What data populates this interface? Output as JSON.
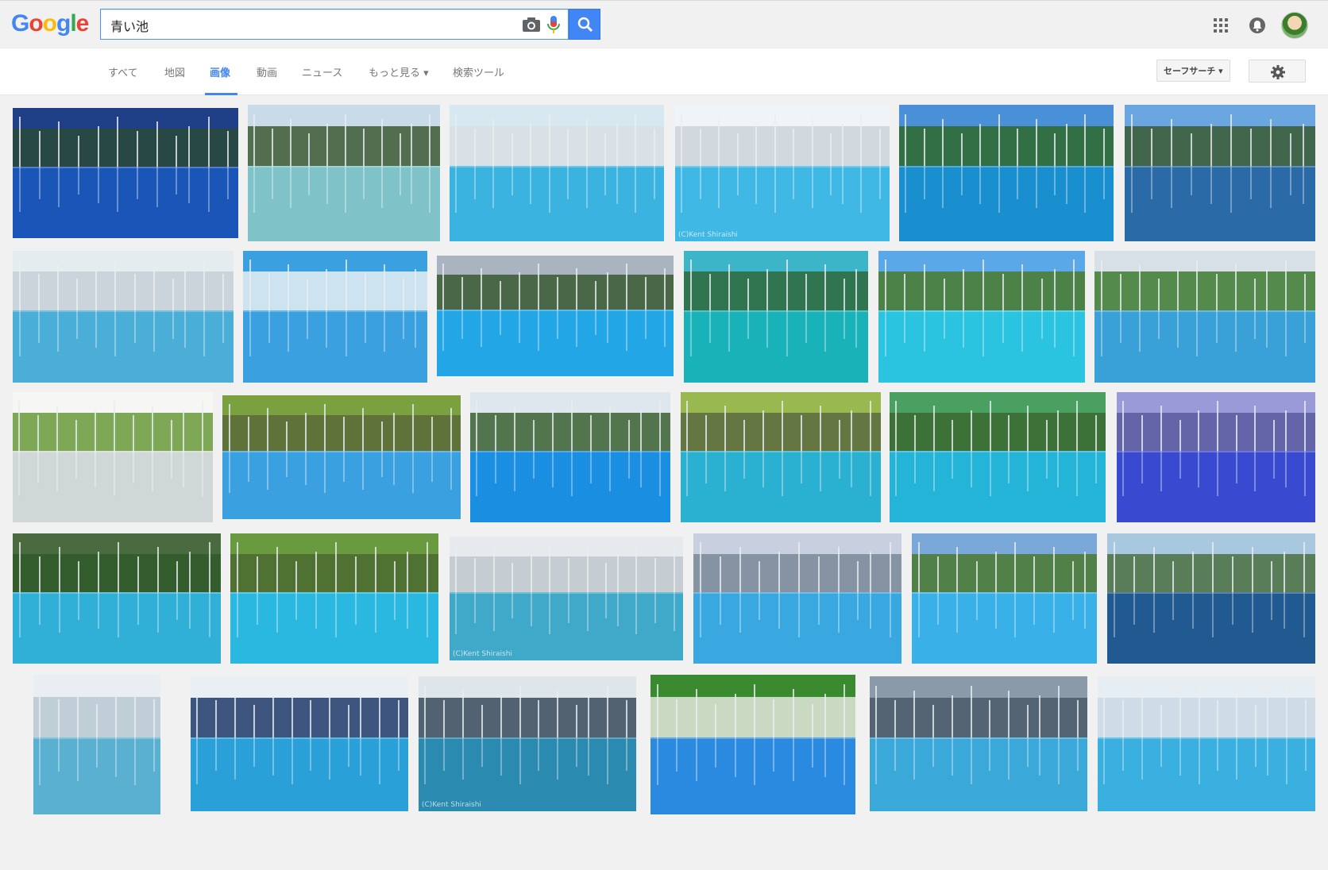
{
  "logo": {
    "letters": [
      "G",
      "o",
      "o",
      "g",
      "l",
      "e"
    ],
    "colors": [
      "#4285f4",
      "#ea4335",
      "#fbbc05",
      "#4285f4",
      "#34a853",
      "#ea4335"
    ]
  },
  "search": {
    "query": "青い池"
  },
  "nav": {
    "tabs": [
      {
        "label": "すべて",
        "active": false
      },
      {
        "label": "地図",
        "active": false
      },
      {
        "label": "画像",
        "active": true
      },
      {
        "label": "動画",
        "active": false
      },
      {
        "label": "ニュース",
        "active": false
      },
      {
        "label": "もっと見る ▾",
        "active": false
      },
      {
        "label": "検索ツール",
        "active": false
      }
    ],
    "safesearch_label": "セーフサーチ ▾"
  },
  "icons": {
    "camera": "camera-icon",
    "mic": "mic-icon",
    "search": "search-icon",
    "apps": "apps-grid-icon",
    "notifications": "notifications-icon",
    "settings": "gear-icon"
  },
  "colors": {
    "accent": "#4285f4",
    "header_bg": "#f1f1f1"
  },
  "images": {
    "rows": [
      [
        {
          "sky": "#1f3f86",
          "trees": "#2a4a3a",
          "water": "#1a56b8",
          "watermark": ""
        },
        {
          "sky": "#c9dbe8",
          "trees": "#3e5a34",
          "water": "#7fc3c8",
          "watermark": ""
        },
        {
          "sky": "#d8e8f0",
          "trees": "#d9dfe4",
          "water": "#3ab3e0",
          "watermark": ""
        },
        {
          "sky": "#eef4f8",
          "trees": "#cbd4da",
          "water": "#3fb8e6",
          "watermark": "(C)Kent Shiraishi"
        },
        {
          "sky": "#4a90d9",
          "trees": "#2f6a2a",
          "water": "#1a8fd0",
          "watermark": ""
        },
        {
          "sky": "#6aa6e0",
          "trees": "#3b5a30",
          "water": "#2a6aa6",
          "watermark": ""
        }
      ],
      [
        {
          "sky": "#e4ecf0",
          "trees": "#c7d0d6",
          "water": "#4aaed6",
          "watermark": ""
        },
        {
          "sky": "#3aa0e0",
          "trees": "#e8eef2",
          "water": "#3aa0e0",
          "watermark": ""
        },
        {
          "sky": "#a9b4c0",
          "trees": "#3a5a32",
          "water": "#22a6e6",
          "watermark": ""
        },
        {
          "sky": "#3db5c8",
          "trees": "#2e6a3a",
          "water": "#18b2b8",
          "watermark": ""
        },
        {
          "sky": "#5aa8e8",
          "trees": "#4a7a2a",
          "water": "#2ac4e0",
          "watermark": ""
        },
        {
          "sky": "#d6e0e6",
          "trees": "#3d7a30",
          "water": "#3aa0d8",
          "watermark": ""
        }
      ],
      [
        {
          "sky": "#f6f6f4",
          "trees": "#6a9a3a",
          "water": "#cfd8d6",
          "watermark": ""
        },
        {
          "sky": "#7aa040",
          "trees": "#5a6a3a",
          "water": "#3aa0e0",
          "watermark": ""
        },
        {
          "sky": "#dfe7ee",
          "trees": "#3a6030",
          "water": "#1a8ee0",
          "watermark": ""
        },
        {
          "sky": "#9ab850",
          "trees": "#5a6a40",
          "water": "#2ab0d0",
          "watermark": ""
        },
        {
          "sky": "#4aa060",
          "trees": "#3a6a30",
          "water": "#24b4d8",
          "watermark": ""
        },
        {
          "sky": "#9a9ad8",
          "trees": "#5a5aa0",
          "water": "#3a4ad0",
          "watermark": ""
        }
      ],
      [
        {
          "sky": "#4a6a40",
          "trees": "#2f5a2a",
          "water": "#30b0d6",
          "watermark": ""
        },
        {
          "sky": "#6a9a40",
          "trees": "#4a6a30",
          "water": "#2ab8e0",
          "watermark": ""
        },
        {
          "sky": "#e6eaee",
          "trees": "#c0c8cc",
          "water": "#40a8c8",
          "watermark": "(C)Kent Shiraishi"
        },
        {
          "sky": "#c8d0e0",
          "trees": "#7a8898",
          "water": "#3aa8e0",
          "watermark": ""
        },
        {
          "sky": "#7aa8d8",
          "trees": "#4a7a30",
          "water": "#3ab0e8",
          "watermark": ""
        },
        {
          "sky": "#a8c8e0",
          "trees": "#4a7040",
          "water": "#205a90",
          "watermark": ""
        }
      ],
      [
        {
          "sky": "#e8eef2",
          "trees": "#b8c8d4",
          "water": "#5ab0d0",
          "watermark": ""
        },
        {
          "sky": "#e8f0f6",
          "trees": "#1e3a6a",
          "water": "#2aa0d8",
          "watermark": ""
        },
        {
          "sky": "#dfe6ea",
          "trees": "#3a4a5a",
          "water": "#2a8ab0",
          "watermark": "(C)Kent Shiraishi"
        },
        {
          "sky": "#3a8a30",
          "trees": "#e4e6dc",
          "water": "#2a8ae0",
          "watermark": ""
        },
        {
          "sky": "#8a9aa8",
          "trees": "#4a5a68",
          "water": "#3aa8d8",
          "watermark": ""
        },
        {
          "sky": "#e6eef4",
          "trees": "#c8d8e4",
          "water": "#3ab0e0",
          "watermark": ""
        }
      ]
    ]
  }
}
